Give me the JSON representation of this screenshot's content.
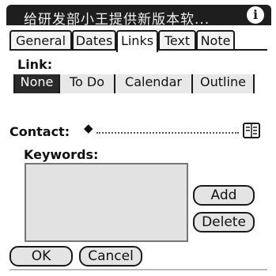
{
  "title": "给研发部小王提供新版本软...",
  "icons": {
    "info": "info-icon",
    "contact_picker": "address-book-icon",
    "diamond": "diamond-icon"
  },
  "tabs": [
    {
      "label": "General",
      "active": false
    },
    {
      "label": "Dates",
      "active": false
    },
    {
      "label": "Links",
      "active": true
    },
    {
      "label": "Text",
      "active": false
    },
    {
      "label": "Note",
      "active": false
    }
  ],
  "link": {
    "label": "Link:",
    "options": [
      "None",
      "To Do",
      "Calendar",
      "Outline"
    ],
    "selected": "None"
  },
  "contact": {
    "label": "Contact:",
    "value": ""
  },
  "keywords": {
    "label": "Keywords:",
    "items": []
  },
  "buttons": {
    "add": "Add",
    "delete": "Delete",
    "ok": "OK",
    "cancel": "Cancel"
  }
}
